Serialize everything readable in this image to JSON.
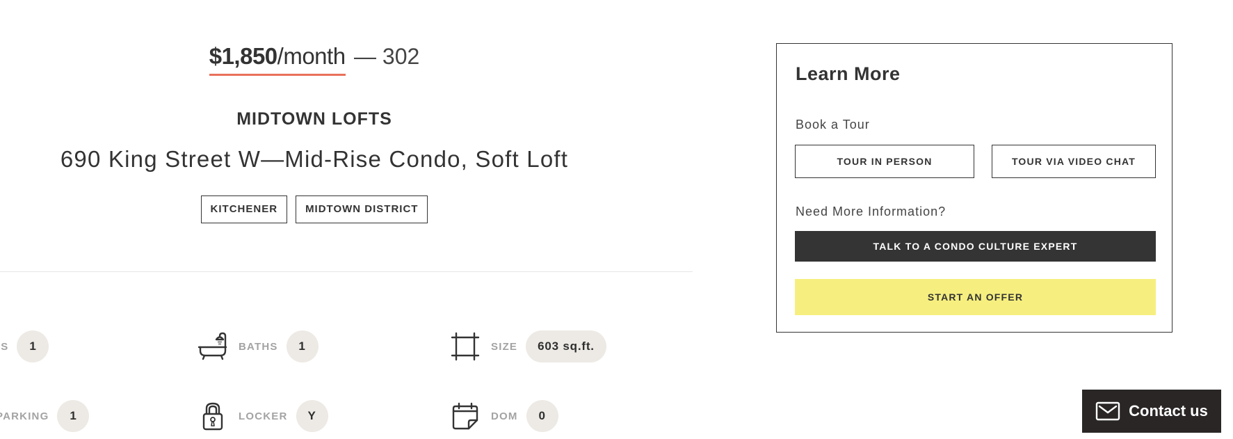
{
  "colors": {
    "accent_underline": "#e8705a",
    "offer_button": "#f6ef7f",
    "dark_button": "#353434",
    "pill_background": "#edeae5",
    "contact_background": "#2b2626"
  },
  "listing": {
    "price": "$1,850",
    "price_period": "/month",
    "separator": "—",
    "unit_number": "302",
    "building_name": "MIDTOWN LOFTS",
    "address_line": "690 King Street W—Mid-Rise Condo, Soft Loft",
    "tags": [
      "KITCHENER",
      "MIDTOWN DISTRICT"
    ]
  },
  "stats": [
    {
      "label": "BEDS",
      "value": "1",
      "icon": "bed-icon"
    },
    {
      "label": "BATHS",
      "value": "1",
      "icon": "bathtub-icon"
    },
    {
      "label": "SIZE",
      "value": "603 sq.ft.",
      "icon": "size-frame-icon"
    },
    {
      "label": "PARKING",
      "value": "1",
      "icon": "parking-icon"
    },
    {
      "label": "LOCKER",
      "value": "Y",
      "icon": "padlock-icon"
    },
    {
      "label": "DOM",
      "value": "0",
      "icon": "calendar-icon"
    }
  ],
  "learn_more": {
    "title": "Learn More",
    "book_tour_label": "Book a Tour",
    "tour_in_person": "TOUR IN PERSON",
    "tour_video": "TOUR VIA VIDEO CHAT",
    "need_info_label": "Need More Information?",
    "talk_expert": "TALK TO A CONDO CULTURE EXPERT",
    "start_offer": "START AN OFFER"
  },
  "contact_widget": {
    "label": "Contact us",
    "icon": "envelope-icon"
  }
}
